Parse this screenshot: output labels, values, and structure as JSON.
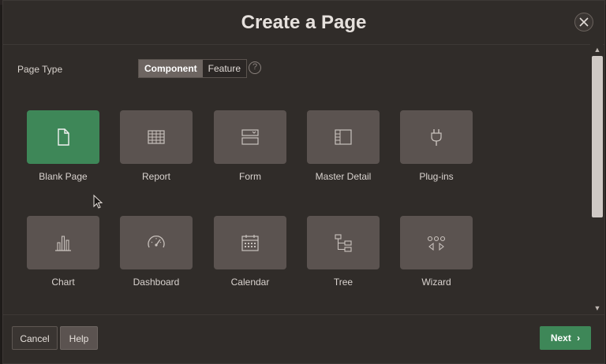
{
  "dialog": {
    "title": "Create a Page"
  },
  "page_type": {
    "label": "Page Type",
    "options": [
      "Component",
      "Feature"
    ],
    "selected": "Component",
    "help_glyph": "?"
  },
  "tiles": [
    {
      "label": "Blank Page",
      "icon": "blank-page-icon",
      "selected": true
    },
    {
      "label": "Report",
      "icon": "report-grid-icon",
      "selected": false
    },
    {
      "label": "Form",
      "icon": "form-icon",
      "selected": false
    },
    {
      "label": "Master Detail",
      "icon": "master-detail-icon",
      "selected": false
    },
    {
      "label": "Plug-ins",
      "icon": "plug-icon",
      "selected": false
    },
    {
      "label": "Chart",
      "icon": "bar-chart-icon",
      "selected": false
    },
    {
      "label": "Dashboard",
      "icon": "gauge-icon",
      "selected": false
    },
    {
      "label": "Calendar",
      "icon": "calendar-icon",
      "selected": false
    },
    {
      "label": "Tree",
      "icon": "tree-icon",
      "selected": false
    },
    {
      "label": "Wizard",
      "icon": "wizard-icon",
      "selected": false
    }
  ],
  "footer": {
    "cancel": "Cancel",
    "help": "Help",
    "next": "Next",
    "next_glyph": "›"
  },
  "close_glyph": "×",
  "colors": {
    "dialog_bg": "#302c29",
    "tile": "#5b5350",
    "accent_green": "#3e8758"
  }
}
